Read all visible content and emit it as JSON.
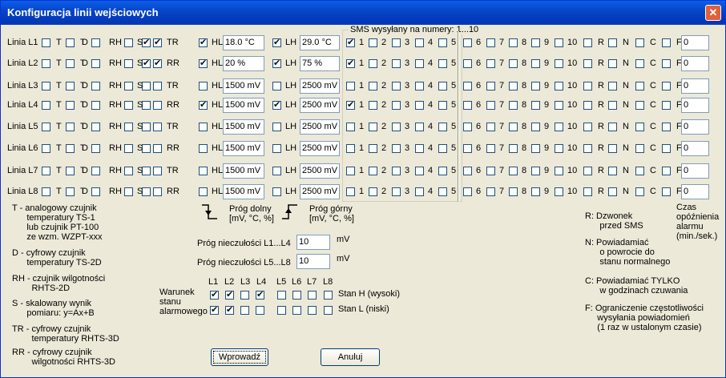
{
  "window": {
    "title": "Konfiguracja linii wejściowych",
    "close": "✕"
  },
  "sms_header": "SMS wysyłany na numery: 1...10",
  "flag_labels": [
    "T",
    "T",
    "D",
    "RH",
    "S"
  ],
  "sms_numbers": [
    "1",
    "2",
    "3",
    "4",
    "5",
    "6",
    "7",
    "8",
    "9",
    "10"
  ],
  "extra_labels": [
    "R",
    "N",
    "C",
    "F"
  ],
  "hl_label": "HL",
  "lh_label": "LH",
  "lines": [
    {
      "name": "Linia L1",
      "flags": [
        false,
        false,
        false,
        false,
        true
      ],
      "tr": "TR",
      "hl_on": true,
      "hl": "18.0 °C",
      "lh_on": true,
      "lh": "29.0 °C",
      "sms": [
        true,
        false,
        false,
        false,
        false,
        false,
        false,
        false,
        false,
        false
      ],
      "extra": [
        false,
        false,
        false,
        false
      ],
      "f": "0"
    },
    {
      "name": "Linia L2",
      "flags": [
        false,
        false,
        false,
        false,
        true
      ],
      "tr": "RR",
      "hl_on": true,
      "hl": "20 %",
      "lh_on": true,
      "lh": "75 %",
      "sms": [
        true,
        false,
        false,
        false,
        false,
        false,
        false,
        false,
        false,
        false
      ],
      "extra": [
        false,
        false,
        false,
        false
      ],
      "f": "0"
    },
    {
      "name": "Linia L3",
      "flags": [
        false,
        false,
        false,
        false,
        false
      ],
      "tr": "TR",
      "hl_on": false,
      "hl": "1500 mV",
      "lh_on": false,
      "lh": "2500 mV",
      "sms": [
        false,
        false,
        false,
        false,
        false,
        false,
        false,
        false,
        false,
        false
      ],
      "extra": [
        false,
        false,
        false,
        false
      ],
      "f": "0"
    },
    {
      "name": "Linia L4",
      "flags": [
        false,
        false,
        false,
        false,
        false
      ],
      "tr": "RR",
      "hl_on": true,
      "hl": "1500 mV",
      "lh_on": true,
      "lh": "2500 mV",
      "sms": [
        true,
        false,
        false,
        false,
        false,
        false,
        false,
        false,
        false,
        false
      ],
      "extra": [
        false,
        false,
        false,
        false
      ],
      "f": "0"
    },
    {
      "name": "Linia L5",
      "flags": [
        false,
        false,
        false,
        false,
        false
      ],
      "tr": "TR",
      "hl_on": false,
      "hl": "1500 mV",
      "lh_on": false,
      "lh": "2500 mV",
      "sms": [
        false,
        false,
        false,
        false,
        false,
        false,
        false,
        false,
        false,
        false
      ],
      "extra": [
        false,
        false,
        false,
        false
      ],
      "f": "0"
    },
    {
      "name": "Linia L6",
      "flags": [
        false,
        false,
        false,
        false,
        false
      ],
      "tr": "RR",
      "hl_on": false,
      "hl": "1500 mV",
      "lh_on": false,
      "lh": "2500 mV",
      "sms": [
        false,
        false,
        false,
        false,
        false,
        false,
        false,
        false,
        false,
        false
      ],
      "extra": [
        false,
        false,
        false,
        false
      ],
      "f": "0"
    },
    {
      "name": "Linia L7",
      "flags": [
        false,
        false,
        false,
        false,
        false
      ],
      "tr": "TR",
      "hl_on": false,
      "hl": "1500 mV",
      "lh_on": false,
      "lh": "2500 mV",
      "sms": [
        false,
        false,
        false,
        false,
        false,
        false,
        false,
        false,
        false,
        false
      ],
      "extra": [
        false,
        false,
        false,
        false
      ],
      "f": "0"
    },
    {
      "name": "Linia L8",
      "flags": [
        false,
        false,
        false,
        false,
        false
      ],
      "tr": "RR",
      "hl_on": false,
      "hl": "1500 mV",
      "lh_on": false,
      "lh": "2500 mV",
      "sms": [
        false,
        false,
        false,
        false,
        false,
        false,
        false,
        false,
        false,
        false
      ],
      "extra": [
        false,
        false,
        false,
        false
      ],
      "f": "0"
    }
  ],
  "prog_dolny": "Próg dolny\n[mV, °C, %]",
  "prog_gorny": "Próg górny\n[mV, °C, %]",
  "insens": [
    {
      "label": "Próg nieczułości L1...L4",
      "value": "10",
      "unit": "mV"
    },
    {
      "label": "Próg nieczułości L5...L8",
      "value": "10",
      "unit": "mV"
    }
  ],
  "warunek": {
    "label": "Warunek\nstanu\nalarmowego",
    "cols": [
      "L1",
      "L2",
      "L3",
      "L4",
      "L5",
      "L6",
      "L7",
      "L8"
    ],
    "rows": [
      {
        "label": "Stan H (wysoki)",
        "checks": [
          true,
          true,
          false,
          true,
          false,
          false,
          false,
          false
        ]
      },
      {
        "label": "Stan L (niski)",
        "checks": [
          true,
          true,
          false,
          false,
          false,
          false,
          false,
          false
        ]
      }
    ]
  },
  "legend_left": [
    "T - analogowy czujnik\n      temperatury TS-1\n      lub czujnik PT-100\n      ze wzm. WZPT-xxx",
    "D - cyfrowy czujnik\n      temperatury TS-2D",
    "RH - czujnik wilgotności\n        RHTS-2D",
    "S - skalowany wynik\n      pomiaru: y=Ax+B",
    "TR - cyfrowy czujnik\n        temperatury RHTS-3D",
    "RR - cyfrowy czujnik\n        wilgotności RHTS-3D"
  ],
  "legend_right": [
    "R: Dzwonek\n      przed SMS",
    "N: Powiadamiać\n      o powrocie do\n      stanu normalnego",
    "C: Powiadamiać TYLKO\n      w godzinach czuwania",
    "F: Ograniczenie częstotliwości\n     wysyłania powiadomień\n     (1 raz w ustalonym czasie)"
  ],
  "czas_label": "Czas\nopóźnienia\nalarmu\n(min./sek.)",
  "buttons": {
    "ok": "Wprowadź",
    "cancel": "Anuluj"
  }
}
